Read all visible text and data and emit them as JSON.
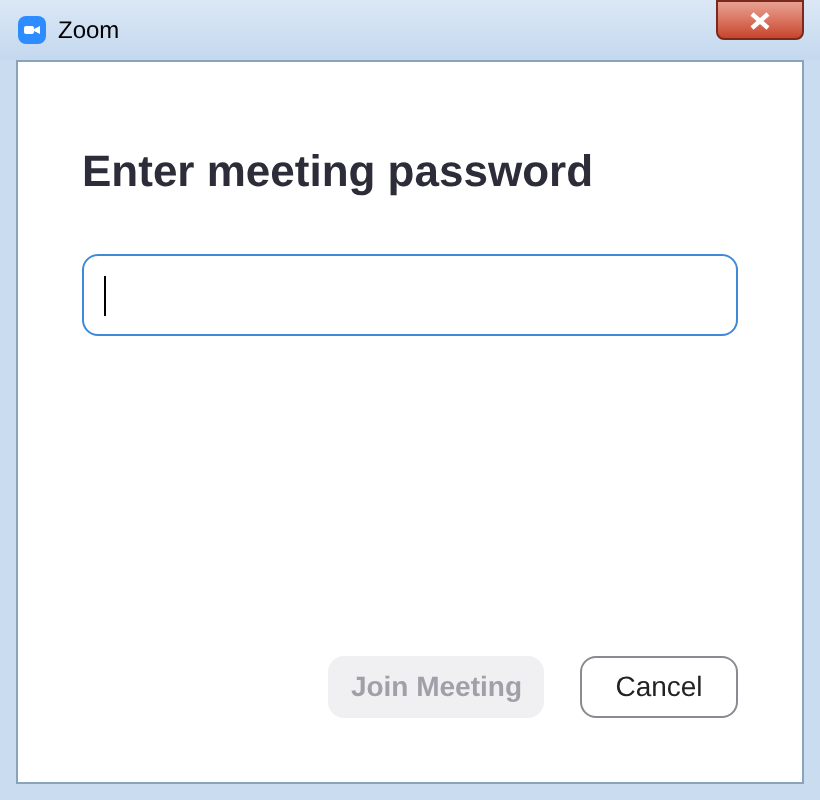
{
  "window": {
    "title": "Zoom"
  },
  "heading": "Enter meeting password",
  "password_field": {
    "focused": true
  },
  "buttons": [
    {
      "label": "Join Meeting",
      "disabled": true
    },
    {
      "label": "Cancel",
      "disabled": false
    }
  ]
}
